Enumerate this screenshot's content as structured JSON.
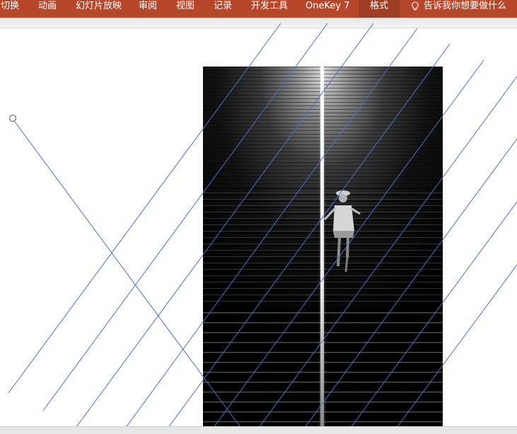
{
  "ribbon": {
    "tabs": [
      {
        "label": "切换"
      },
      {
        "label": "动画"
      },
      {
        "label": "幻灯片放映"
      },
      {
        "label": "审阅"
      },
      {
        "label": "视图"
      },
      {
        "label": "记录"
      },
      {
        "label": "开发工具"
      },
      {
        "label": "OneKey 7"
      },
      {
        "label": "格式",
        "active": true
      }
    ],
    "tell_me": {
      "icon": "lightbulb-icon",
      "label": "告诉我你想要做什么"
    }
  },
  "colors": {
    "ribbon_bg": "#b7472a",
    "active_tab_bg": "#9c3d24",
    "line_color": "#4a6fc9",
    "handle_color": "#888888"
  },
  "slide": {
    "picture": "black-and-white-photo-person-walking-down-stairs",
    "selected_shape": "line-with-endpoint-handle"
  }
}
